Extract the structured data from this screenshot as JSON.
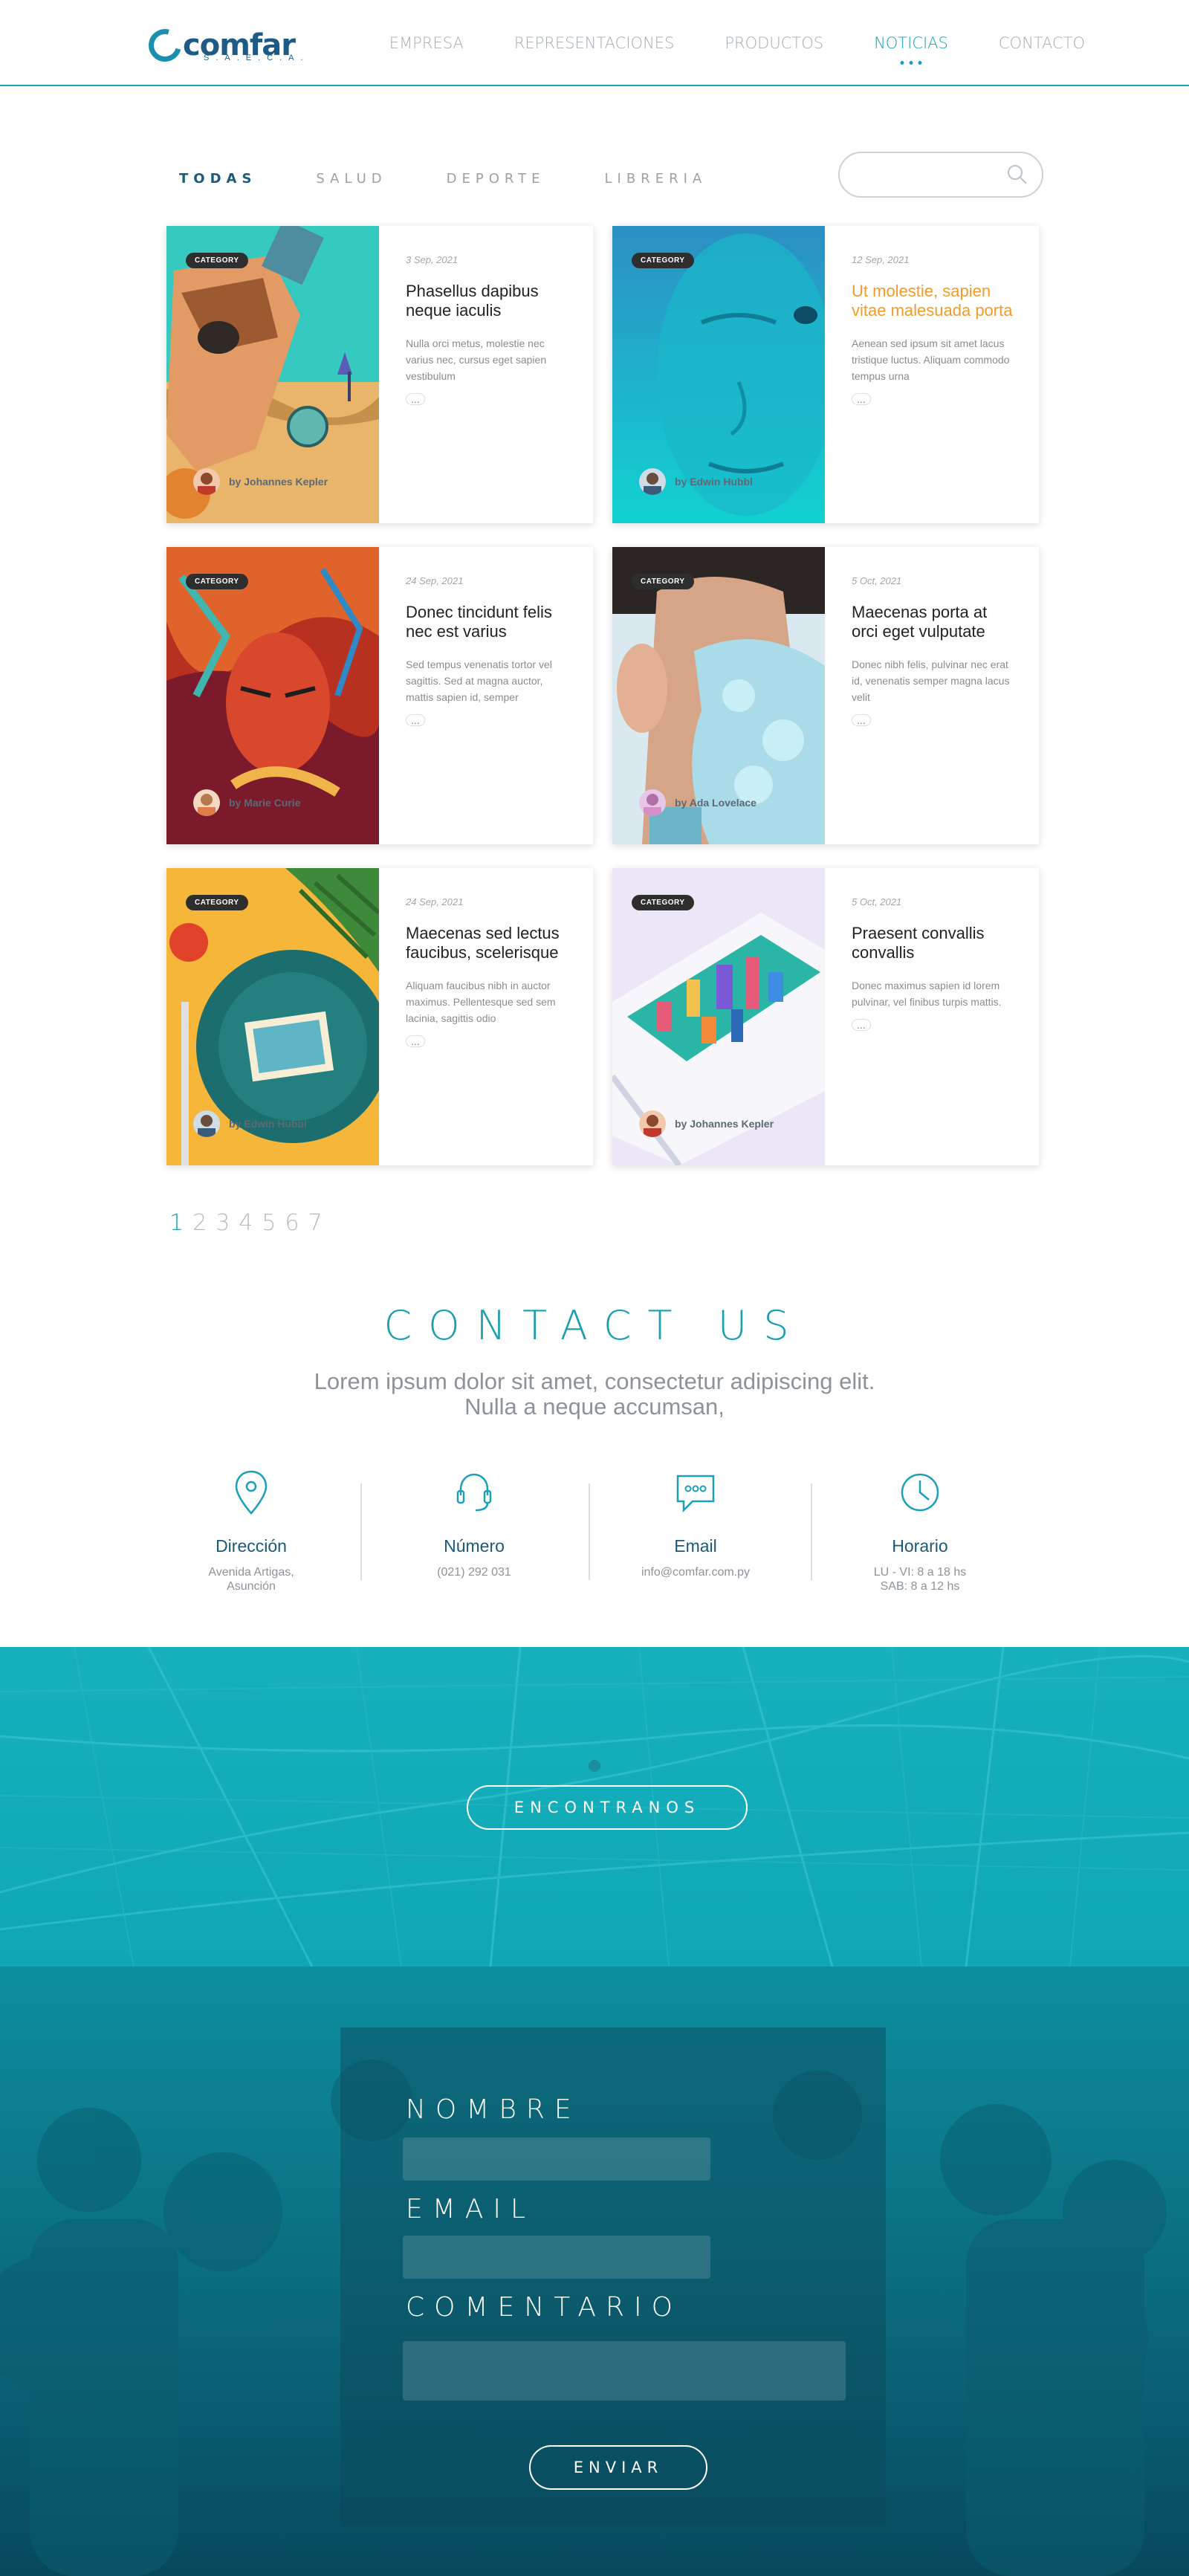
{
  "header": {
    "logo_text": "comfar",
    "logo_sub": "S.A.E.C.A.",
    "nav": [
      {
        "label": "EMPRESA"
      },
      {
        "label": "REPRESENTACIONES"
      },
      {
        "label": "PRODUCTOS"
      },
      {
        "label": "NOTICIAS",
        "active": true
      },
      {
        "label": "CONTACTO"
      }
    ]
  },
  "filters": [
    "TODAS",
    "SALUD",
    "DEPORTE",
    "LIBRERIA"
  ],
  "search": {
    "placeholder": "",
    "icon": "search-icon"
  },
  "cards": [
    {
      "badge": "CATEGORY",
      "date": "3 Sep, 2021",
      "title": "Phasellus dapibus neque iaculis",
      "excerpt": "Nulla orci metus, molestie nec varius nec, cursus eget sapien vestibulum",
      "more": "...",
      "author": "by Johannes Kepler"
    },
    {
      "badge": "CATEGORY",
      "date": "12 Sep, 2021",
      "title": "Ut molestie, sapien vitae malesuada porta",
      "excerpt": "Aenean sed ipsum sit amet lacus tristique luctus. Aliquam commodo tempus urna",
      "more": "...",
      "author": "by Edwin Hubbl"
    },
    {
      "badge": "CATEGORY",
      "date": "24 Sep, 2021",
      "title": "Donec tincidunt felis nec est varius",
      "excerpt": "Sed tempus venenatis tortor vel sagittis. Sed at magna auctor, mattis sapien id, semper",
      "more": "...",
      "author": "by Marie Curie"
    },
    {
      "badge": "CATEGORY",
      "date": "5 Oct, 2021",
      "title": "Maecenas porta at orci eget vulputate",
      "excerpt": "Donec nibh felis, pulvinar nec erat id, venenatis semper magna lacus velit",
      "more": "...",
      "author": "by Ada Lovelace"
    },
    {
      "badge": "CATEGORY",
      "date": "24 Sep, 2021",
      "title": "Maecenas sed lectus faucibus, scelerisque",
      "excerpt": "Aliquam faucibus nibh in auctor maximus. Pellentesque sed sem lacinia, sagittis odio",
      "more": "...",
      "author": "by Edwin Hubbl"
    },
    {
      "badge": "CATEGORY",
      "date": "5 Oct, 2021",
      "title": "Praesent convallis convallis",
      "excerpt": "Donec maximus sapien id lorem pulvinar, vel finibus turpis mattis.",
      "more": "...",
      "author": "by Johannes Kepler"
    }
  ],
  "pagination": [
    "1",
    "2",
    "3",
    "4",
    "5",
    "6",
    "7"
  ],
  "contact": {
    "title": "CONTACT US",
    "subtitle": "Lorem ipsum dolor sit amet, consectetur adipiscing elit. Nulla a neque accumsan,",
    "items": [
      {
        "icon": "location-pin-icon",
        "label": "Dirección",
        "value": "Avenida Artigas, Asunción"
      },
      {
        "icon": "headset-icon",
        "label": "Número",
        "value": "(021) 292 031"
      },
      {
        "icon": "chat-bubble-icon",
        "label": "Email",
        "value": "info@comfar.com.py"
      },
      {
        "icon": "clock-icon",
        "label": "Horario",
        "value": "LU - VI: 8 a 18 hs\nSAB: 8 a 12 hs"
      }
    ]
  },
  "map": {
    "button": "ENCONTRANOS"
  },
  "form": {
    "name_label": "NOMBRE",
    "email_label": "EMAIL",
    "comment_label": "COMENTARIO",
    "submit": "ENVIAR"
  },
  "colors": {
    "accent": "#1aa0b8",
    "orange": "#f29b28",
    "brand": "#1d5a86"
  }
}
